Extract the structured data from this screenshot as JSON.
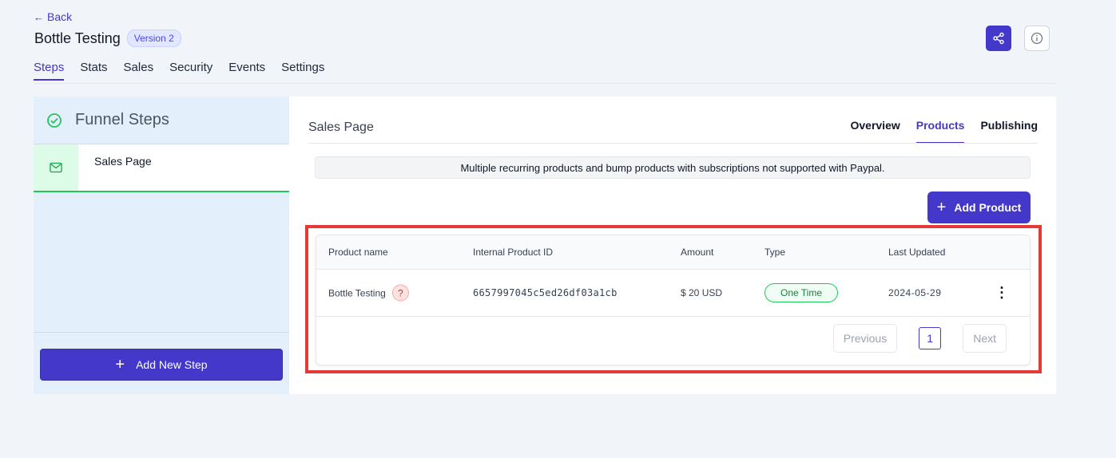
{
  "header": {
    "back_label": "Back",
    "title": "Bottle Testing",
    "version": "Version 2"
  },
  "tabs": [
    {
      "label": "Steps"
    },
    {
      "label": "Stats"
    },
    {
      "label": "Sales"
    },
    {
      "label": "Security"
    },
    {
      "label": "Events"
    },
    {
      "label": "Settings"
    }
  ],
  "active_tab": "Steps",
  "sidebar": {
    "title": "Funnel Steps",
    "steps": [
      {
        "label": "Sales Page"
      }
    ],
    "add_step_label": "Add New Step"
  },
  "main": {
    "section_title": "Sales Page",
    "subtabs": [
      {
        "label": "Overview"
      },
      {
        "label": "Products"
      },
      {
        "label": "Publishing"
      }
    ],
    "active_subtab": "Products",
    "notice": "Multiple recurring products and bump products with subscriptions not supported with Paypal.",
    "add_product_label": "Add Product"
  },
  "table": {
    "headers": [
      "Product name",
      "Internal Product ID",
      "Amount",
      "Type",
      "Last Updated"
    ],
    "rows": [
      {
        "name": "Bottle Testing",
        "help_glyph": "?",
        "id": "6657997045c5ed26df03a1cb",
        "amount": "$ 20 USD",
        "type": "One Time",
        "updated": "2024-05-29"
      }
    ]
  },
  "pagination": {
    "previous": "Previous",
    "page": "1",
    "next": "Next"
  },
  "colors": {
    "accent": "#4338ca",
    "success": "#22c55e",
    "highlight": "#e53935"
  }
}
